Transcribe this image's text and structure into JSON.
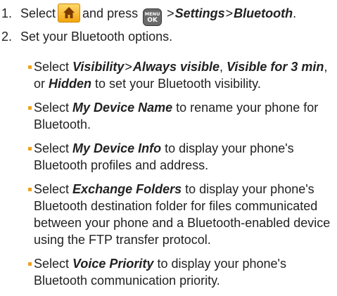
{
  "steps": [
    {
      "number": "1.",
      "select": "Select",
      "and_press": "and press",
      "path_sep_1": ">",
      "path_1": "Settings",
      "path_sep_2": ">",
      "path_2": "Bluetooth",
      "end": ".",
      "home_key_icon": "home-key-icon",
      "menu_key": {
        "top": "MENU",
        "bottom": "OK"
      }
    },
    {
      "number": "2.",
      "text": "Set your Bluetooth options."
    }
  ],
  "bullets": [
    {
      "select": "Select",
      "term_1": "Visibility",
      "sep": ">",
      "term_2": "Always visible",
      "comma_1": ",",
      "term_3": "Visible for 3 min",
      "or": ", or",
      "term_4": "Hidden",
      "rest": "to set your Bluetooth visibility."
    },
    {
      "select": "Select",
      "term": "My Device Name",
      "rest": "to rename your phone for Bluetooth."
    },
    {
      "select": "Select",
      "term": "My Device Info",
      "rest": "to display your phone's Bluetooth profiles and address."
    },
    {
      "select": "Select",
      "term": "Exchange Folders",
      "rest": "to display your phone's Bluetooth destination folder for files communicated between your phone and a Bluetooth-enabled device using the FTP transfer protocol."
    },
    {
      "select": "Select",
      "term": "Voice Priority",
      "rest": "to display your phone's Bluetooth communication priority."
    }
  ],
  "colors": {
    "bullet": "#f2a11b",
    "home_key": "#f3a510",
    "menu_key": "#6a6a6a"
  }
}
